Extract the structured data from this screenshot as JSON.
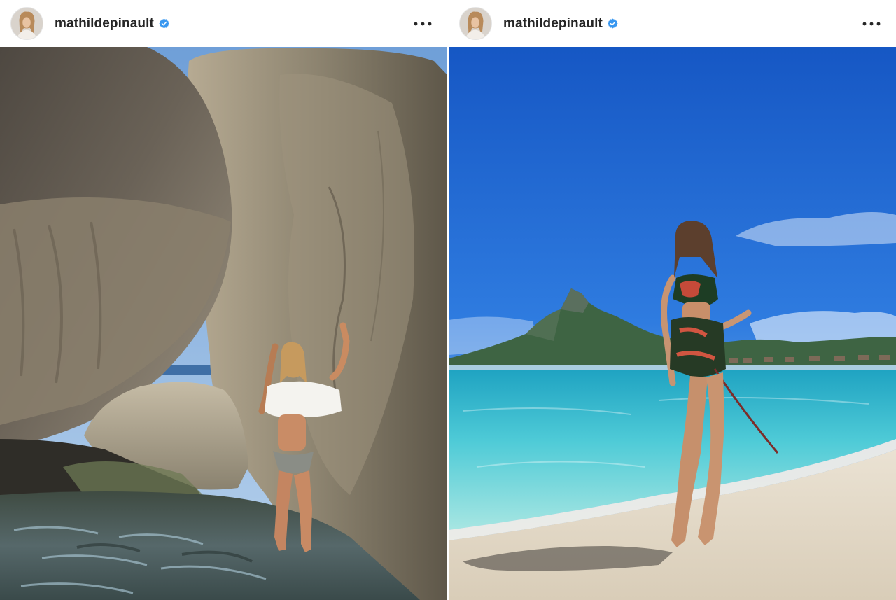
{
  "posts": [
    {
      "username": "mathildepinault",
      "verified": true,
      "photo_alt": "woman posing between large granite boulders in shallow water"
    },
    {
      "username": "mathildepinault",
      "verified": true,
      "photo_alt": "woman posing on a white sand beach with turquoise lagoon and mountain"
    }
  ],
  "icons": {
    "verified": "verified-badge-icon",
    "more": "more-options-icon"
  },
  "colors": {
    "verified_blue": "#3897f0",
    "username_text": "#262626"
  }
}
